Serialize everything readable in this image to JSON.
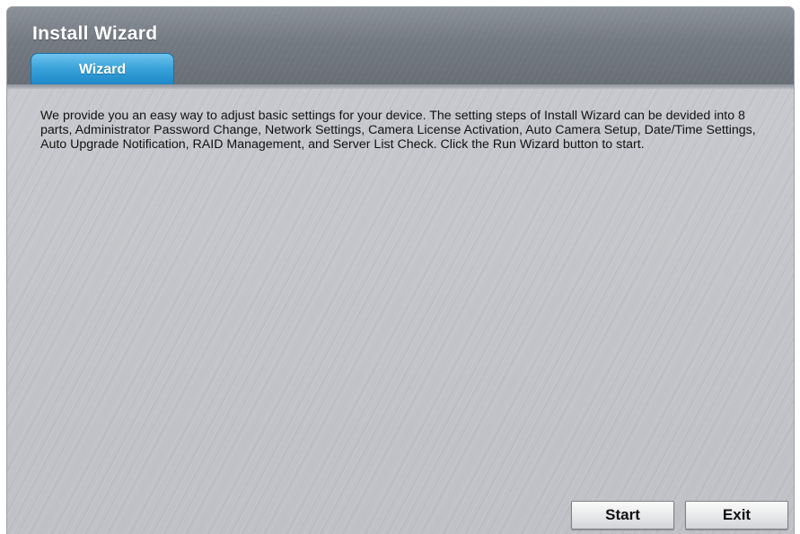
{
  "window": {
    "title": "Install Wizard"
  },
  "tabs": [
    {
      "label": "Wizard",
      "active": true
    }
  ],
  "content": {
    "description": "We provide you an easy way to adjust basic settings for your device. The setting steps of Install Wizard can be devided into 8 parts, Administrator Password Change,  Network Settings, Camera License Activation, Auto Camera Setup, Date/Time Settings, Auto Upgrade Notification, RAID Management, and Server List Check. Click the Run Wizard button to start."
  },
  "buttons": {
    "start_label": "Start",
    "exit_label": "Exit"
  },
  "colors": {
    "titlebar": "#737981",
    "tab_active": "#3aa3db",
    "panel_bg": "#c4c6cb"
  }
}
